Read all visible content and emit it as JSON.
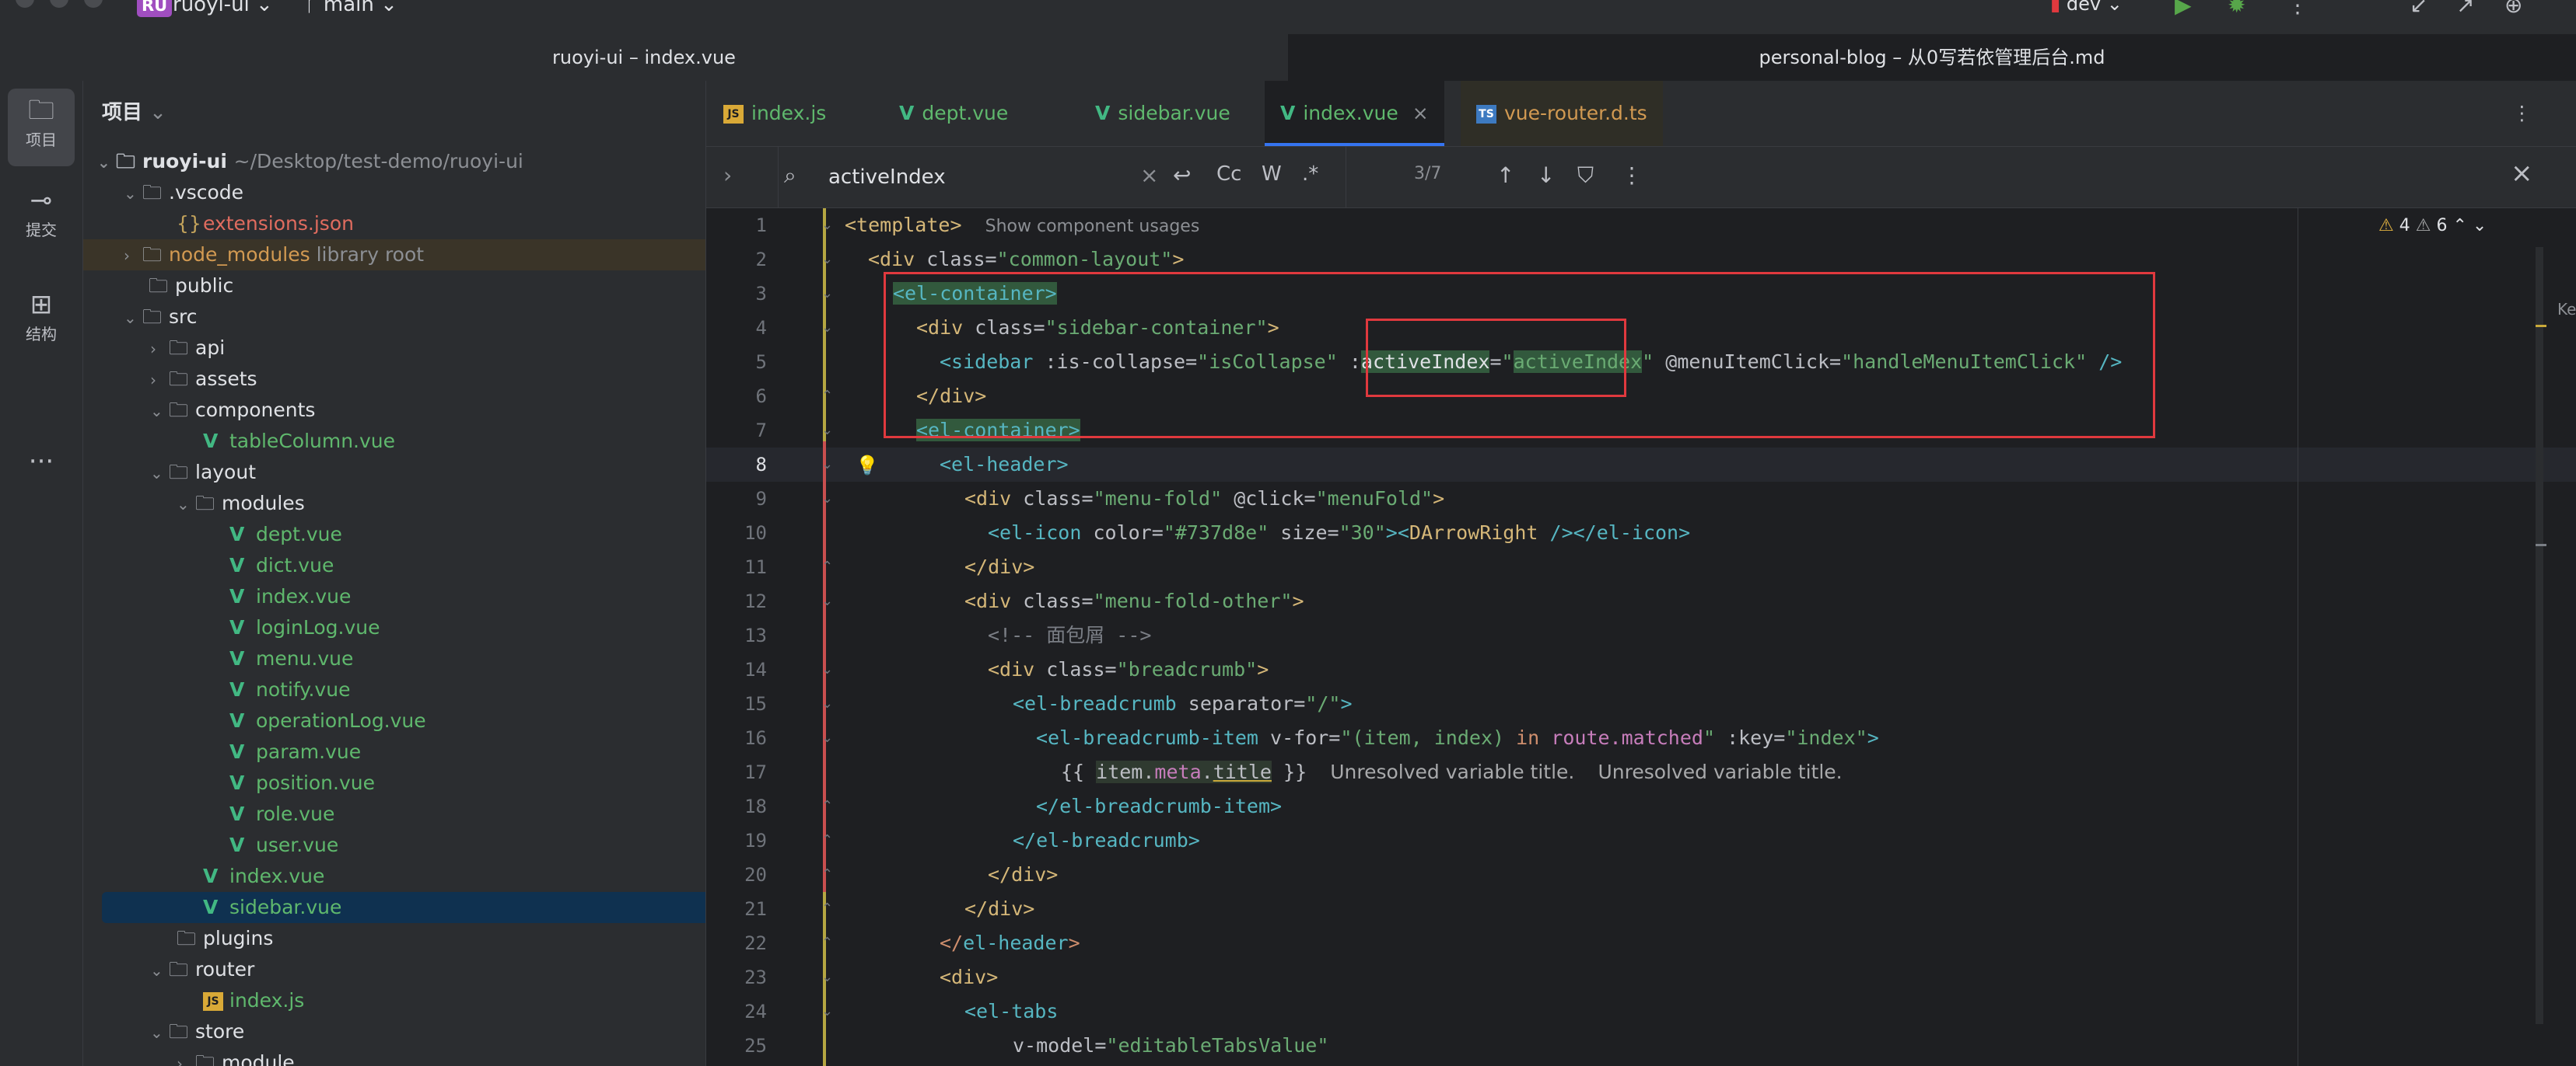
{
  "titlebar": {
    "project_badge": "RU",
    "project_name": "ruoyi-ui",
    "branch": "main",
    "run_config": "dev"
  },
  "window_tabs": [
    "ruoyi-ui – index.vue",
    "personal-blog – 从0写若依管理后台.md"
  ],
  "tool_strip": {
    "project": "项目",
    "commit": "提交",
    "structure": "结构",
    "more": "···"
  },
  "project_panel": {
    "title": "项目",
    "tree": [
      {
        "label": "ruoyi-ui",
        "hint": "~/Desktop/test-demo/ruoyi-ui"
      },
      {
        "label": ".vscode"
      },
      {
        "label": "extensions.json"
      },
      {
        "label": "node_modules",
        "hint": "library root"
      },
      {
        "label": "public"
      },
      {
        "label": "src"
      },
      {
        "label": "api"
      },
      {
        "label": "assets"
      },
      {
        "label": "components"
      },
      {
        "label": "tableColumn.vue"
      },
      {
        "label": "layout"
      },
      {
        "label": "modules"
      },
      {
        "label": "dept.vue"
      },
      {
        "label": "dict.vue"
      },
      {
        "label": "index.vue"
      },
      {
        "label": "loginLog.vue"
      },
      {
        "label": "menu.vue"
      },
      {
        "label": "notify.vue"
      },
      {
        "label": "operationLog.vue"
      },
      {
        "label": "param.vue"
      },
      {
        "label": "position.vue"
      },
      {
        "label": "role.vue"
      },
      {
        "label": "user.vue"
      },
      {
        "label": "index.vue"
      },
      {
        "label": "sidebar.vue"
      },
      {
        "label": "plugins"
      },
      {
        "label": "router"
      },
      {
        "label": "index.js"
      },
      {
        "label": "store"
      },
      {
        "label": "module"
      }
    ]
  },
  "editor_tabs": [
    "index.js",
    "dept.vue",
    "sidebar.vue",
    "index.vue",
    "vue-router.d.ts"
  ],
  "search": {
    "query": "activeIndex",
    "case_btn": "Cc",
    "word_btn": "W",
    "regex_btn": ".*",
    "match_count": "3/7"
  },
  "editor": {
    "warnings": "4",
    "weak_warnings": "6",
    "edge_text": "Ke",
    "line_numbers": [
      "1",
      "2",
      "3",
      "4",
      "5",
      "6",
      "7",
      "8",
      "9",
      "10",
      "11",
      "12",
      "13",
      "14",
      "15",
      "16",
      "17",
      "18",
      "19",
      "20",
      "21",
      "22",
      "23",
      "24",
      "25"
    ],
    "usage_hint": "Show component usages",
    "unresolved_1": "Unresolved variable title.",
    "unresolved_2": "Unresolved variable title."
  }
}
